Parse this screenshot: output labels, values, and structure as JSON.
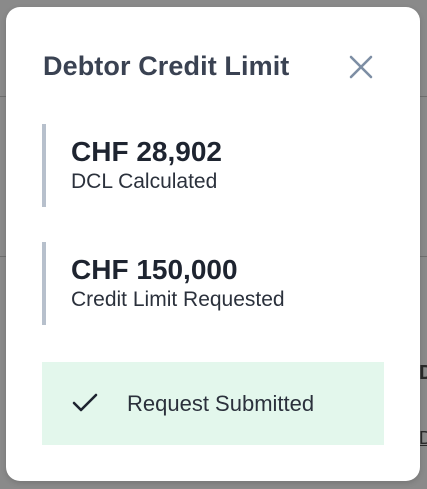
{
  "dialog": {
    "title": "Debtor Credit Limit",
    "close_icon": "close-icon"
  },
  "metrics": [
    {
      "value": "CHF 28,902",
      "label": "DCL Calculated"
    },
    {
      "value": "CHF 150,000",
      "label": "Credit Limit Requested"
    }
  ],
  "status": {
    "icon": "check-icon",
    "text": "Request Submitted",
    "color": "#e3f7ec"
  },
  "background": {
    "peek_heading": "D",
    "peek_link": "D"
  },
  "colors": {
    "overlay": "#8a8a8a",
    "accent_bar": "#b7c0cc",
    "title": "#3a4252"
  }
}
